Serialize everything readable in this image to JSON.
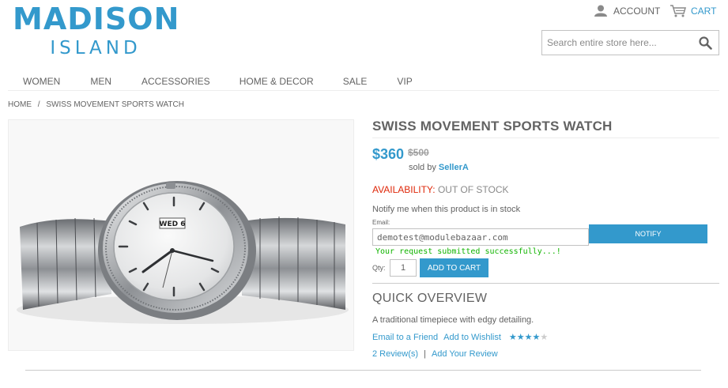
{
  "logo": {
    "main": "MADISON",
    "sub": "ISLAND"
  },
  "header": {
    "account_label": "ACCOUNT",
    "cart_label": "CART",
    "search_placeholder": "Search entire store here..."
  },
  "nav": {
    "items": [
      {
        "label": "WOMEN"
      },
      {
        "label": "MEN"
      },
      {
        "label": "ACCESSORIES"
      },
      {
        "label": "HOME & DECOR"
      },
      {
        "label": "SALE"
      },
      {
        "label": "VIP"
      }
    ]
  },
  "breadcrumb": {
    "home": "HOME",
    "separator": "/",
    "current": "SWISS MOVEMENT SPORTS WATCH"
  },
  "product": {
    "title": "SWISS MOVEMENT SPORTS WATCH",
    "price": "$360",
    "old_price": "$500",
    "sold_by_prefix": "sold by",
    "seller": "SellerA",
    "availability_label": "AVAILABILITY:",
    "availability_value": "OUT OF STOCK",
    "notify_text": "Notify me when this product is in stock",
    "email_label": "Email:",
    "email_value": "demotest@modulebazaar.com",
    "notify_button": "NOTIFY",
    "success_message": "Your request submitted successfully...!",
    "qty_label": "Qty:",
    "qty_value": "1",
    "add_to_cart": "ADD TO CART",
    "watch_date_label": "WED 6",
    "overview_title": "QUICK OVERVIEW",
    "overview_text": "A traditional timepiece with edgy detailing.",
    "email_friend": "Email to a Friend",
    "add_wishlist": "Add to Wishlist",
    "rating": 4,
    "rating_max": 5,
    "reviews_link": "2 Review(s)",
    "reviews_separator": "|",
    "add_review": "Add Your Review"
  },
  "colors": {
    "brand": "#3399cc",
    "text": "#636363",
    "availability_label": "#df280a",
    "success": "#11b400",
    "star_filled": "#3399cc",
    "star_empty": "#cccccc"
  }
}
